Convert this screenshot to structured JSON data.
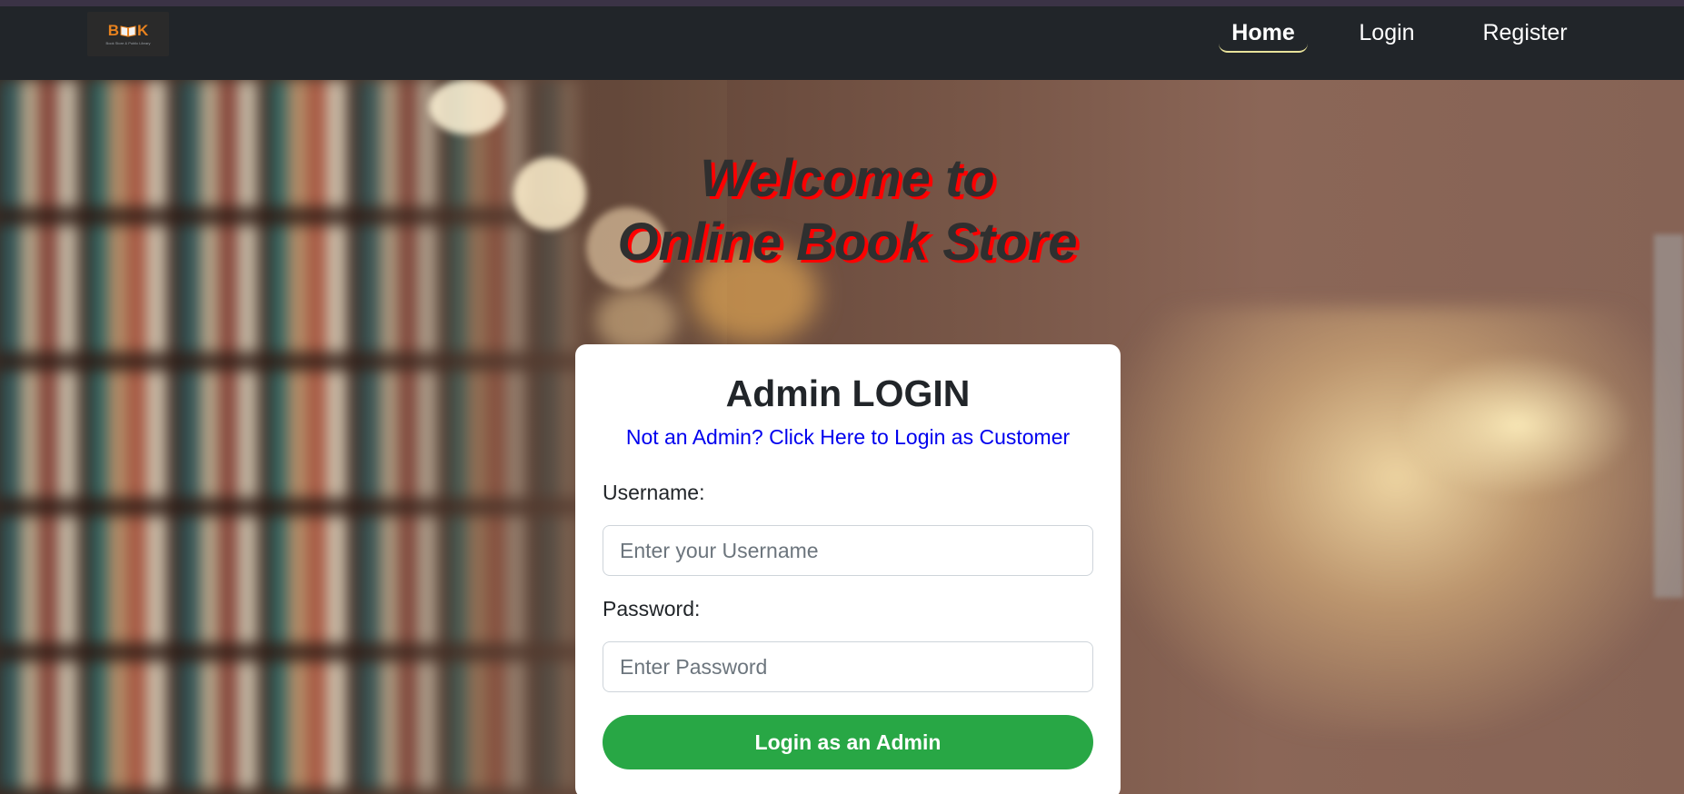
{
  "app": {
    "logo_text_left": "B",
    "logo_text_right": "K",
    "logo_tagline": "Book Store & Public Library"
  },
  "nav": {
    "items": [
      {
        "label": "Home",
        "active": true
      },
      {
        "label": "Login",
        "active": false
      },
      {
        "label": "Register",
        "active": false
      }
    ]
  },
  "hero": {
    "title_line1": "Welcome to",
    "title_line2": "Online Book Store"
  },
  "login_form": {
    "heading": "Admin LOGIN",
    "switch_link": "Not an Admin? Click Here to Login as Customer",
    "username_label": "Username:",
    "username_placeholder": "Enter your Username",
    "password_label": "Password:",
    "password_placeholder": "Enter Password",
    "submit_label": "Login as an Admin"
  },
  "colors": {
    "navbar": "#212529",
    "primary_button": "#28a745",
    "link": "#0000ee",
    "title_text": "#2f2f2f",
    "title_shadow": "#ff0000",
    "logo_accent": "#e8821e"
  }
}
